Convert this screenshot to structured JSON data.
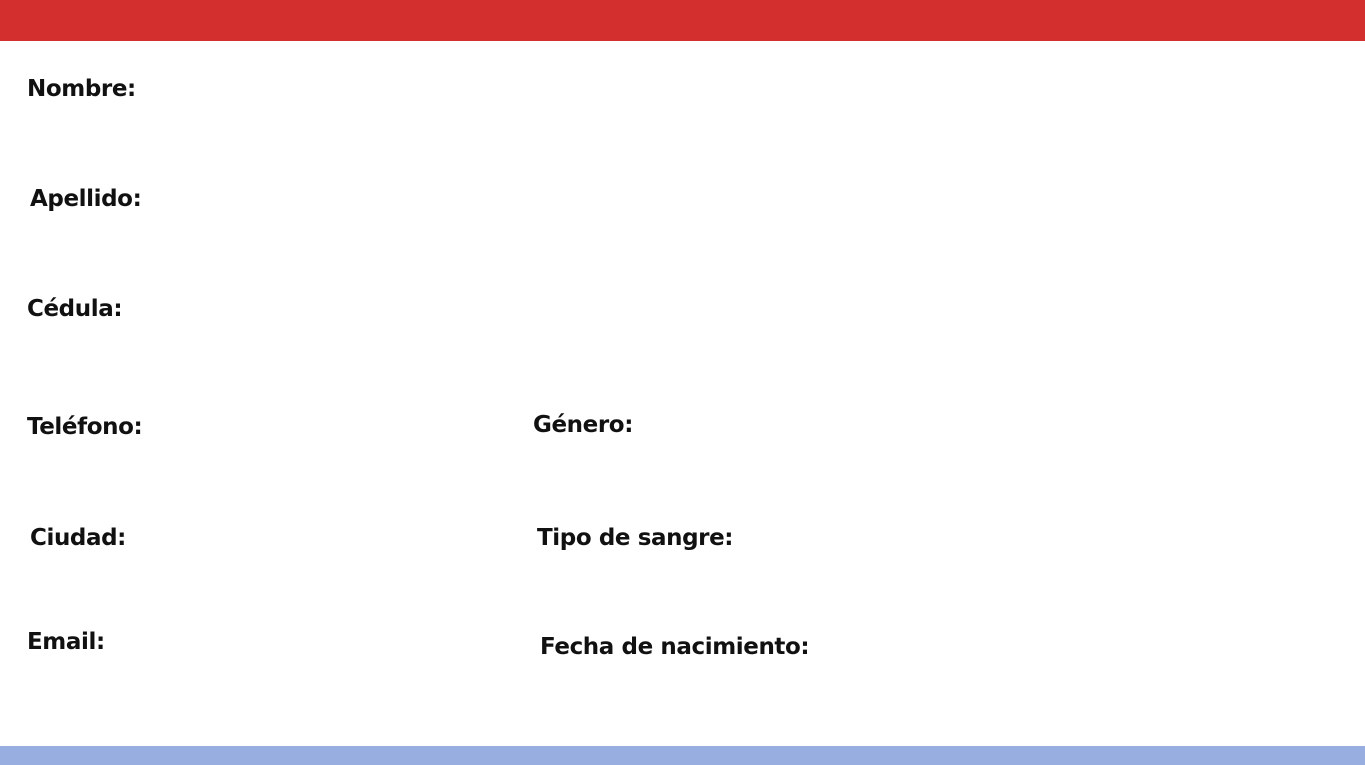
{
  "colors": {
    "header_bar": "#d32f2f",
    "footer_bar": "#99aee0",
    "label_text": "#111111",
    "background": "#ffffff"
  },
  "form": {
    "nombre_label": "Nombre:",
    "apellido_label": "Apellido:",
    "cedula_label": "Cédula:",
    "telefono_label": "Teléfono:",
    "ciudad_label": "Ciudad:",
    "email_label": "Email:",
    "genero_label": "Género:",
    "tipo_sangre_label": "Tipo de sangre:",
    "fecha_nacimiento_label": "Fecha de nacimiento:"
  }
}
